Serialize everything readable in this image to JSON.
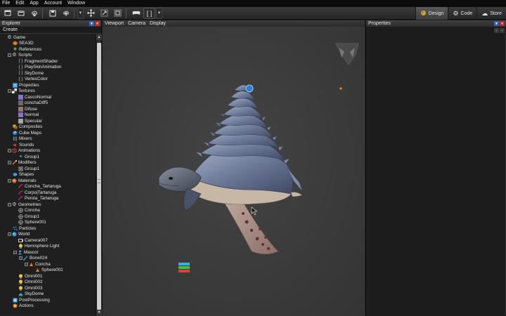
{
  "menu": [
    "File",
    "Edit",
    "App",
    "Account",
    "Window"
  ],
  "toolbar": {
    "icons": [
      "new-icon",
      "open-icon",
      "import-icon",
      "save-icon",
      "publish-icon",
      "move-icon",
      "rotate-icon",
      "scale-icon",
      "gamepad-icon",
      "brackets-icon"
    ],
    "brackets_label": "[ ]"
  },
  "modes": [
    {
      "label": "Design",
      "icon": "design-icon",
      "active": true
    },
    {
      "label": "Code",
      "icon": "gear-icon",
      "active": false
    },
    {
      "label": "Store",
      "icon": "cloud-icon",
      "active": false
    }
  ],
  "explorer": {
    "title": "Explorer",
    "create": "Create",
    "tree": [
      {
        "label": "Game",
        "depth": 0,
        "exp": "",
        "icon": "game-icon",
        "color": "#d0d0d0"
      },
      {
        "label": "SEA3D",
        "depth": 1,
        "exp": "",
        "icon": "sea3d-icon",
        "color": "#e07a2a"
      },
      {
        "label": "References",
        "depth": 1,
        "exp": "",
        "icon": "references-icon",
        "color": "#4caf50"
      },
      {
        "label": "Scripts",
        "depth": 1,
        "exp": "−",
        "icon": "scripts-gear-icon",
        "color": "#d0d0d0"
      },
      {
        "label": "FragmentShader",
        "depth": 2,
        "exp": "",
        "icon": "script-braces-icon",
        "color": "#d0d0d0"
      },
      {
        "label": "PlaySkinAnimation",
        "depth": 2,
        "exp": "",
        "icon": "script-braces-icon",
        "color": "#d0d0d0"
      },
      {
        "label": "SkyDome",
        "depth": 2,
        "exp": "",
        "icon": "script-braces-icon",
        "color": "#d0d0d0"
      },
      {
        "label": "VertexColor",
        "depth": 2,
        "exp": "",
        "icon": "script-braces-icon",
        "color": "#d0d0d0"
      },
      {
        "label": "Properties",
        "depth": 1,
        "exp": "",
        "icon": "properties-icon",
        "color": "#3a8ee0"
      },
      {
        "label": "Textures",
        "depth": 1,
        "exp": "−",
        "icon": "checker-icon",
        "color": "#d0d0d0"
      },
      {
        "label": "CascoNormal",
        "depth": 2,
        "exp": "",
        "icon": "texture-swatch-icon",
        "color": "#8a6fd6"
      },
      {
        "label": "conchaDiff5",
        "depth": 2,
        "exp": "",
        "icon": "texture-swatch-icon",
        "color": "#6a6a6a"
      },
      {
        "label": "Difuse",
        "depth": 2,
        "exp": "",
        "icon": "texture-swatch-icon",
        "color": "#9a7a6a"
      },
      {
        "label": "Normal",
        "depth": 2,
        "exp": "",
        "icon": "texture-swatch-icon",
        "color": "#8a6fd6"
      },
      {
        "label": "Specular",
        "depth": 2,
        "exp": "",
        "icon": "texture-swatch-icon",
        "color": "#aaaaaa"
      },
      {
        "label": "Composites",
        "depth": 1,
        "exp": "",
        "icon": "composites-icon",
        "color": "#e0b030"
      },
      {
        "label": "Cube Maps",
        "depth": 1,
        "exp": "",
        "icon": "cube-map-icon",
        "color": "#3aa0e0"
      },
      {
        "label": "Mixers",
        "depth": 1,
        "exp": "",
        "icon": "mixers-icon",
        "color": "#3aa0e0"
      },
      {
        "label": "Sounds",
        "depth": 1,
        "exp": "",
        "icon": "sounds-icon",
        "color": "#d04040"
      },
      {
        "label": "Animations",
        "depth": 1,
        "exp": "−",
        "icon": "animations-icon",
        "color": "#d04040"
      },
      {
        "label": "Group1",
        "depth": 2,
        "exp": "",
        "icon": "animation-run-icon",
        "color": "#3aa0e0"
      },
      {
        "label": "Modifiers",
        "depth": 1,
        "exp": "−",
        "icon": "modifiers-icon",
        "color": "#e07a2a"
      },
      {
        "label": "Group1",
        "depth": 2,
        "exp": "",
        "icon": "modifier-item-icon",
        "color": "#d0d0d0"
      },
      {
        "label": "Shapes",
        "depth": 1,
        "exp": "",
        "icon": "shapes-icon",
        "color": "#3aa0e0"
      },
      {
        "label": "Materials",
        "depth": 1,
        "exp": "−",
        "icon": "materials-sphere-icon",
        "color": "#e07a2a"
      },
      {
        "label": "Concha_Tartaruga",
        "depth": 2,
        "exp": "",
        "icon": "material-stroke-icon",
        "color": "#c02060"
      },
      {
        "label": "Corpo|Tartaruga",
        "depth": 2,
        "exp": "",
        "icon": "material-stroke-icon",
        "color": "#c02060"
      },
      {
        "label": "Perola_Tartaruga",
        "depth": 2,
        "exp": "",
        "icon": "material-stroke-icon",
        "color": "#c02060"
      },
      {
        "label": "Geometries",
        "depth": 1,
        "exp": "−",
        "icon": "geometries-icon",
        "color": "#d0d0d0"
      },
      {
        "label": "Concha",
        "depth": 2,
        "exp": "",
        "icon": "geometry-icon",
        "color": "#d0d0d0"
      },
      {
        "label": "Group1",
        "depth": 2,
        "exp": "",
        "icon": "geometry-icon",
        "color": "#d0d0d0"
      },
      {
        "label": "Sphere001",
        "depth": 2,
        "exp": "",
        "icon": "geometry-icon",
        "color": "#d0d0d0"
      },
      {
        "label": "Particles",
        "depth": 1,
        "exp": "",
        "icon": "particles-icon",
        "color": "#3aa0e0"
      },
      {
        "label": "World",
        "depth": 1,
        "exp": "−",
        "icon": "world-globe-icon",
        "color": "#3aa0e0"
      },
      {
        "label": "Camera007",
        "depth": 2,
        "exp": "",
        "icon": "camera-icon",
        "color": "#d0d0d0"
      },
      {
        "label": "Hemisphere Light",
        "depth": 2,
        "exp": "",
        "icon": "light-bulb-icon",
        "color": "#f0c040"
      },
      {
        "label": "Mascot",
        "depth": 2,
        "exp": "−",
        "icon": "mascot-icon",
        "color": "#3aa0e0"
      },
      {
        "label": "Bone024",
        "depth": 3,
        "exp": "−",
        "icon": "bone-icon",
        "color": "#3aa0e0"
      },
      {
        "label": "Concha",
        "depth": 4,
        "exp": "−",
        "icon": "mesh-icon",
        "color": "#e07a2a"
      },
      {
        "label": "Sphere001",
        "depth": 5,
        "exp": "",
        "icon": "mesh-icon",
        "color": "#e07a2a"
      },
      {
        "label": "Omni001",
        "depth": 2,
        "exp": "",
        "icon": "light-bulb-icon",
        "color": "#f0c040"
      },
      {
        "label": "Omni002",
        "depth": 2,
        "exp": "",
        "icon": "light-bulb-icon",
        "color": "#f0c040"
      },
      {
        "label": "Omni003",
        "depth": 2,
        "exp": "",
        "icon": "light-bulb-icon",
        "color": "#f0c040"
      },
      {
        "label": "SkyDome",
        "depth": 2,
        "exp": "",
        "icon": "skydome-icon",
        "color": "#3aa0e0"
      },
      {
        "label": "PostProcessing",
        "depth": 1,
        "exp": "",
        "icon": "postprocessing-icon",
        "color": "#3aa0e0"
      },
      {
        "label": "Actions",
        "depth": 1,
        "exp": "",
        "icon": "actions-icon",
        "color": "#e07a2a"
      }
    ]
  },
  "viewport": {
    "tabs": [
      "Viewport",
      "Camera",
      "Display"
    ]
  },
  "properties": {
    "title": "Properties"
  }
}
